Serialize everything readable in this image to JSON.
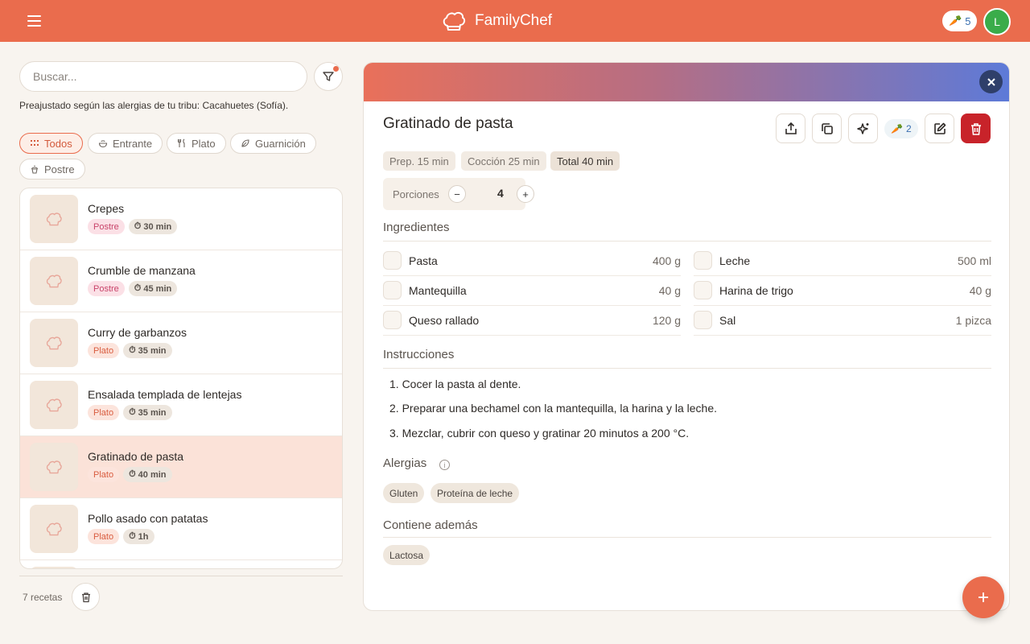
{
  "header": {
    "app_name": "FamilyChef",
    "carrot_count": "5",
    "avatar_letter": "L"
  },
  "search": {
    "placeholder": "Buscar..."
  },
  "allergy_note": "Preajustado según las alergias de tu tribu: Cacahuetes (Sofía).",
  "categories": [
    {
      "label": "Todos",
      "icon": "grid-icon",
      "active": true
    },
    {
      "label": "Entrante",
      "icon": "bowl-icon"
    },
    {
      "label": "Plato",
      "icon": "cutlery-icon"
    },
    {
      "label": "Guarnición",
      "icon": "leaf-icon"
    },
    {
      "label": "Postre",
      "icon": "cupcake-icon"
    }
  ],
  "recipes": [
    {
      "name": "Crepes",
      "category": "Postre",
      "time": "30 min"
    },
    {
      "name": "Crumble de manzana",
      "category": "Postre",
      "time": "45 min"
    },
    {
      "name": "Curry de garbanzos",
      "category": "Plato",
      "time": "35 min"
    },
    {
      "name": "Ensalada templada de lentejas",
      "category": "Plato",
      "time": "35 min"
    },
    {
      "name": "Gratinado de pasta",
      "category": "Plato",
      "time": "40 min",
      "selected": true
    },
    {
      "name": "Pollo asado con patatas",
      "category": "Plato",
      "time": "1h"
    }
  ],
  "recipe_count": "7 recetas",
  "detail": {
    "title": "Gratinado de pasta",
    "carrot_count": "2",
    "times": {
      "prep": "Prep. 15 min",
      "cook": "Cocción 25 min",
      "total": "Total 40 min"
    },
    "portions_label": "Porciones",
    "portions": "4",
    "ingredients_title": "Ingredientes",
    "ingredients": [
      {
        "name": "Pasta",
        "qty": "400 g"
      },
      {
        "name": "Leche",
        "qty": "500 ml"
      },
      {
        "name": "Mantequilla",
        "qty": "40 g"
      },
      {
        "name": "Harina de trigo",
        "qty": "40 g"
      },
      {
        "name": "Queso rallado",
        "qty": "120 g"
      },
      {
        "name": "Sal",
        "qty": "1 pizca"
      }
    ],
    "instructions_title": "Instrucciones",
    "instructions": [
      "1. Cocer la pasta al dente.",
      "2. Preparar una bechamel con la mantequilla, la harina y la leche.",
      "3. Mezclar, cubrir con queso y gratinar 20 minutos a 200 °C."
    ],
    "allergies_title": "Alergias",
    "allergies": [
      "Gluten",
      "Proteína de leche"
    ],
    "contains_title": "Contiene además",
    "contains": [
      "Lactosa"
    ]
  },
  "colors": {
    "primary": "#ea6c4d",
    "danger": "#c8232a",
    "avatar": "#3aac4a"
  }
}
